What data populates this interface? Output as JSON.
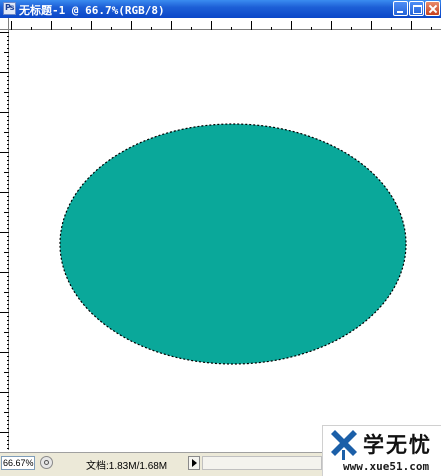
{
  "window": {
    "title": "无标题-1 @ 66.7%(RGB/8)",
    "app_icon": "photoshop-document-icon",
    "buttons": [
      "minimize-icon",
      "maximize-icon",
      "close-icon"
    ]
  },
  "canvas": {
    "background_color": "#ffffff",
    "shape": {
      "type": "ellipse",
      "fill_color": "#0aa89a",
      "selection": "marching-ants"
    }
  },
  "status": {
    "zoom": "66.67%",
    "doc_info": "文档:1.83M/1.68M"
  },
  "watermark": {
    "name": "学无忧",
    "url": "www.xue51.com"
  }
}
